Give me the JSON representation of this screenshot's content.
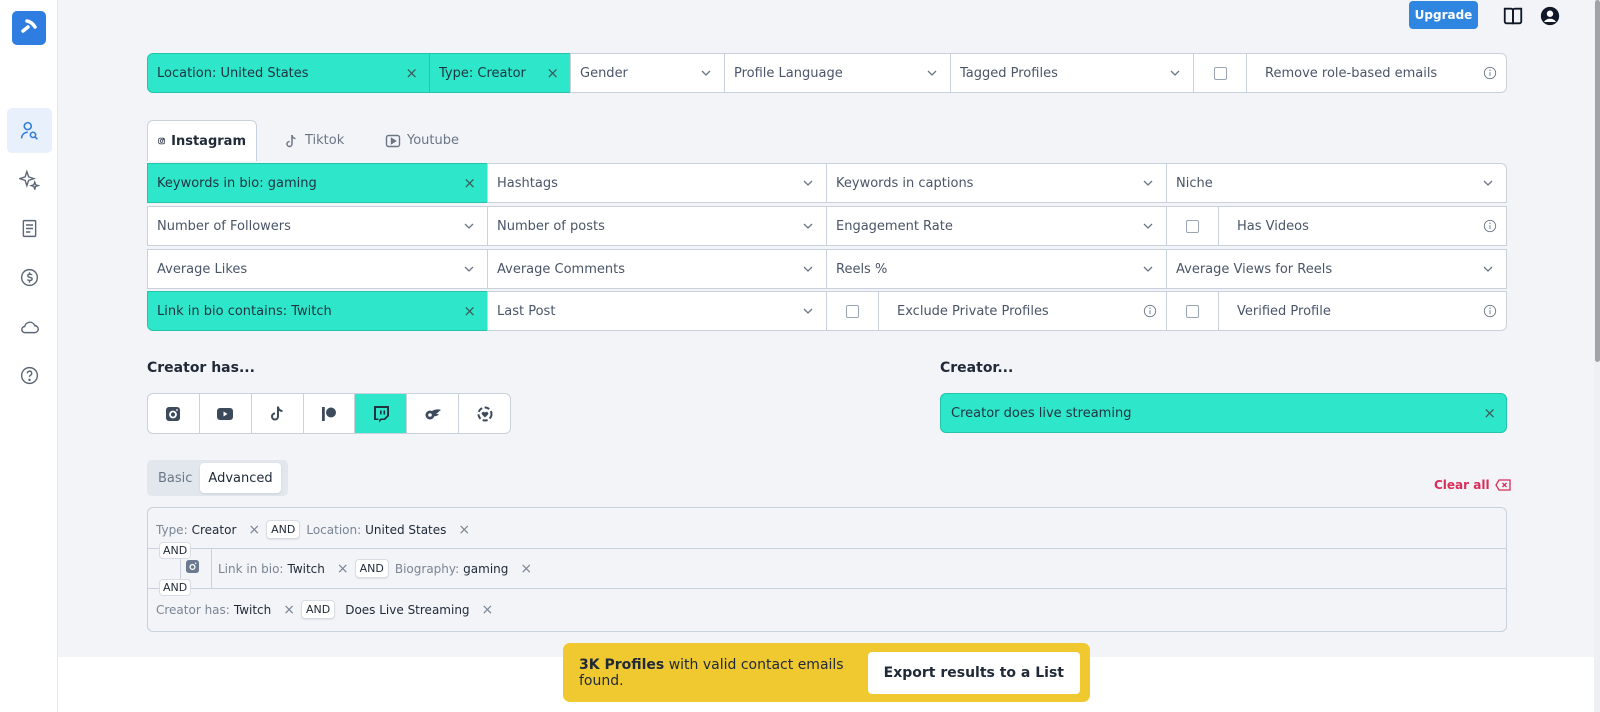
{
  "header": {
    "upgrade_label": "Upgrade",
    "icons": [
      "book-icon",
      "user-account-icon"
    ]
  },
  "sidebar": {
    "items": [
      {
        "name": "creator-search",
        "icon": "user-search-icon",
        "active": true
      },
      {
        "name": "ai-features",
        "icon": "sparkles-icon",
        "active": false
      },
      {
        "name": "lists",
        "icon": "document-icon",
        "active": false
      },
      {
        "name": "billing",
        "icon": "dollar-icon",
        "active": false
      },
      {
        "name": "integrations",
        "icon": "cloud-icon",
        "active": false
      },
      {
        "name": "help",
        "icon": "help-icon",
        "active": false
      }
    ]
  },
  "global_filters": {
    "location": "Location: United States",
    "type": "Type: Creator",
    "gender": "Gender",
    "profile_language": "Profile Language",
    "tagged_profiles": "Tagged Profiles",
    "remove_role_emails": "Remove role-based emails",
    "remove_role_emails_checked": false
  },
  "platform_tabs": [
    {
      "label": "Instagram",
      "active": true
    },
    {
      "label": "Tiktok",
      "active": false
    },
    {
      "label": "Youtube",
      "active": false
    }
  ],
  "instagram_filters": {
    "keywords_bio": "Keywords in bio: gaming",
    "hashtags": "Hashtags",
    "keywords_captions": "Keywords in captions",
    "niche": "Niche",
    "followers": "Number of Followers",
    "posts": "Number of posts",
    "engagement": "Engagement Rate",
    "has_videos": "Has Videos",
    "has_videos_checked": false,
    "avg_likes": "Average Likes",
    "avg_comments": "Average Comments",
    "reels_pct": "Reels %",
    "avg_views_reels": "Average Views for Reels",
    "link_in_bio": "Link in bio contains: Twitch",
    "last_post": "Last Post",
    "exclude_private": "Exclude Private Profiles",
    "exclude_private_checked": false,
    "verified": "Verified Profile",
    "verified_checked": false
  },
  "creator_has": {
    "title": "Creator has...",
    "platforms": [
      {
        "name": "instagram",
        "selected": false
      },
      {
        "name": "youtube",
        "selected": false
      },
      {
        "name": "tiktok",
        "selected": false
      },
      {
        "name": "patreon",
        "selected": false
      },
      {
        "name": "twitch",
        "selected": true
      },
      {
        "name": "onlyfans",
        "selected": false
      },
      {
        "name": "other-social",
        "selected": false
      }
    ]
  },
  "creator": {
    "title": "Creator...",
    "chip": "Creator does live streaming"
  },
  "mode": {
    "basic": "Basic",
    "advanced": "Advanced",
    "active": "Advanced"
  },
  "clear_all": "Clear all",
  "query": {
    "and": "AND",
    "row1": [
      {
        "key": "Type:",
        "value": "Creator"
      },
      {
        "key": "Location:",
        "value": "United States"
      }
    ],
    "row2": [
      {
        "key": "Link in bio:",
        "value": "Twitch"
      },
      {
        "key": "Biography:",
        "value": "gaming"
      }
    ],
    "row3": [
      {
        "key": "Creator has:",
        "value": "Twitch"
      },
      {
        "key": "",
        "value": "Does Live Streaming"
      }
    ]
  },
  "results": {
    "count": "3K Profiles",
    "suffix": " with valid contact emails found.",
    "export_label": "Export results to a List"
  },
  "colors": {
    "accent_teal": "#2ee6c9",
    "brand_blue": "#2f7de1",
    "banner_yellow": "#f0c930",
    "clear_red": "#d92d5a"
  }
}
